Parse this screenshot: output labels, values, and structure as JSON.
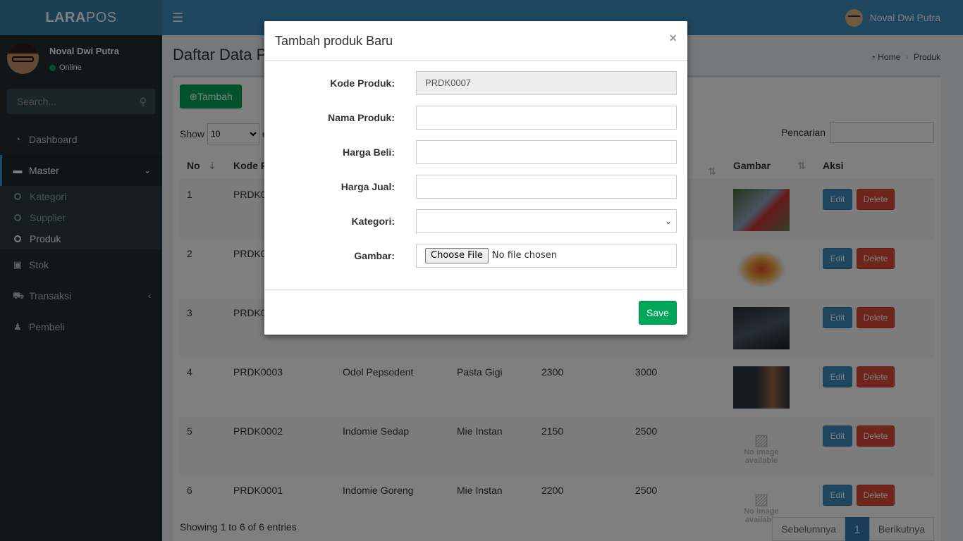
{
  "header": {
    "logo_bold": "LARA",
    "logo_rest": "POS",
    "user_name": "Noval Dwi Putra"
  },
  "sidebar": {
    "user_name": "Noval Dwi Putra",
    "status": "Online",
    "search_placeholder": "Search...",
    "items": [
      {
        "label": "Dashboard",
        "icon": "dashboard-icon"
      },
      {
        "label": "Master",
        "icon": "folder-icon"
      },
      {
        "label": "Stok",
        "icon": "briefcase-icon"
      },
      {
        "label": "Transaksi",
        "icon": "cart-icon"
      },
      {
        "label": "Pembeli",
        "icon": "user-plus-icon"
      }
    ],
    "sub_items": [
      "Kategori",
      "Supplier",
      "Produk"
    ]
  },
  "page": {
    "title": "Daftar Data P",
    "breadcrumb_home": "Home",
    "breadcrumb_current": "Produk",
    "add_button": "Tambah",
    "show_label": "Show",
    "show_value": "10",
    "show_suffix": "e",
    "search_label": "Pencarian",
    "columns": [
      "No",
      "Kode P",
      "Gambar",
      "Aksi"
    ],
    "rows": [
      {
        "no": "1",
        "kode": "PRDK00",
        "nama": "",
        "kategori": "",
        "beli": "",
        "jual": ""
      },
      {
        "no": "2",
        "kode": "PRDK00",
        "nama": "",
        "kategori": "",
        "beli": "",
        "jual": ""
      },
      {
        "no": "3",
        "kode": "PRDK00",
        "nama": "",
        "kategori": "",
        "beli": "",
        "jual": ""
      },
      {
        "no": "4",
        "kode": "PRDK0003",
        "nama": "Odol Pepsodent",
        "kategori": "Pasta Gigi",
        "beli": "2300",
        "jual": "3000"
      },
      {
        "no": "5",
        "kode": "PRDK0002",
        "nama": "Indomie Sedap",
        "kategori": "Mie Instan",
        "beli": "2150",
        "jual": "2500"
      },
      {
        "no": "6",
        "kode": "PRDK0001",
        "nama": "Indomie Goreng",
        "kategori": "Mie Instan",
        "beli": "2200",
        "jual": "2500"
      }
    ],
    "edit_label": "Edit",
    "delete_label": "Delete",
    "no_image_line1": "No image",
    "no_image_line2": "available",
    "info": "Showing 1 to 6 of 6 entries",
    "pager_prev": "Sebelumnya",
    "pager_current": "1",
    "pager_next": "Berikutnya"
  },
  "modal": {
    "title": "Tambah produk Baru",
    "close": "×",
    "fields": [
      {
        "label": "Kode Produk:",
        "value": "PRDK0007"
      },
      {
        "label": "Nama Produk:",
        "value": ""
      },
      {
        "label": "Harga Beli:",
        "value": ""
      },
      {
        "label": "Harga Jual:",
        "value": ""
      },
      {
        "label": "Kategori:",
        "value": ""
      },
      {
        "label": "Gambar:",
        "value": ""
      }
    ],
    "file_button": "Choose File",
    "file_status": "No file chosen",
    "save": "Save"
  }
}
